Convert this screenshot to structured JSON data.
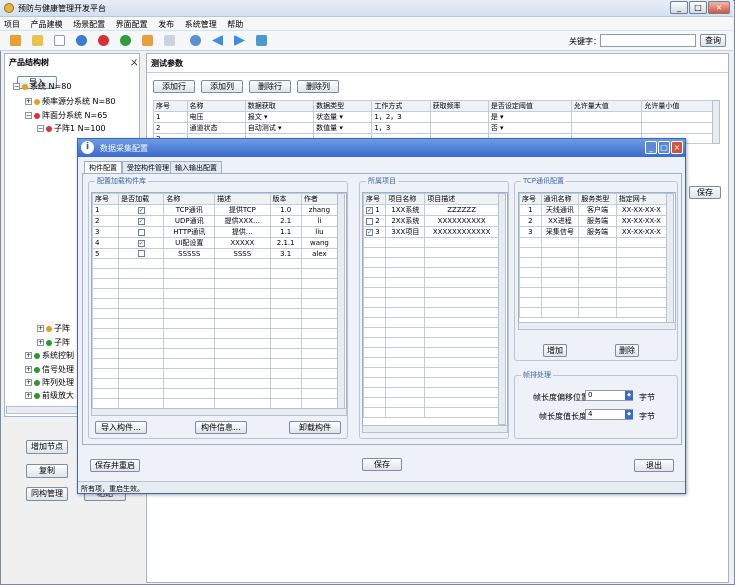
{
  "app": {
    "title": "预防与健康管理开发平台",
    "window_controls": [
      "_",
      "□",
      "×"
    ]
  },
  "menu": [
    "项目",
    "产品建模",
    "场景配置",
    "界面配置",
    "发布",
    "系统管理",
    "帮助"
  ],
  "toolbar": {
    "keyword_label": "关键字：",
    "search_button": "查询",
    "keyword_value": ""
  },
  "left_panel": {
    "title": "产品结构树",
    "pin": "ㄨ",
    "import_button": "导入",
    "tree": [
      {
        "label": "系统 N=80",
        "color": "#e0a020",
        "level": 0,
        "exp": "−"
      },
      {
        "label": "频率源分系统 N=80",
        "color": "#e0a020",
        "level": 1,
        "exp": "+"
      },
      {
        "label": "阵面分系统 N=65",
        "color": "#e03030",
        "level": 1,
        "exp": "−"
      },
      {
        "label": "子阵1 N=100",
        "color": "#e03030",
        "level": 2,
        "exp": "−"
      },
      {
        "label": "子阵",
        "color": "#e0a020",
        "level": 2,
        "exp": "+"
      },
      {
        "label": "子阵",
        "color": "#2a9a2a",
        "level": 2,
        "exp": "+"
      },
      {
        "label": "系统控制",
        "color": "#2a9a2a",
        "level": 1,
        "exp": "+"
      },
      {
        "label": "信号处理",
        "color": "#2a9a2a",
        "level": 1,
        "exp": "+"
      },
      {
        "label": "阵列处理",
        "color": "#2a9a2a",
        "level": 1,
        "exp": "+"
      },
      {
        "label": "前级放大",
        "color": "#2a9a2a",
        "level": 1,
        "exp": "+"
      }
    ],
    "buttons": {
      "add_node": "增加节点",
      "copy": "复制",
      "sync": "同构管理",
      "paste": "粘贴"
    }
  },
  "test_params": {
    "title": "测试参数",
    "buttons": [
      "添加行",
      "添加列",
      "删除行",
      "删除列"
    ],
    "headers": [
      "序号",
      "名称",
      "数据获取",
      "数据类型",
      "工作方式",
      "获取频率",
      "是否设定阈值",
      "允许量大值",
      "允许量小值"
    ],
    "rows": [
      [
        "1",
        "电压",
        "报文",
        "状态量",
        "1，2，3",
        "",
        "是",
        "",
        ""
      ],
      [
        "2",
        "通道状态",
        "自动测试",
        "数值量",
        "1，3",
        "",
        "否",
        "",
        ""
      ],
      [
        "3",
        "",
        "",
        "",
        "",
        "",
        "",
        "",
        ""
      ]
    ],
    "save_button": "保存"
  },
  "dialog": {
    "title": "数据采集配置",
    "tabs": [
      "构件配置",
      "受控构件管理",
      "输入输出配置"
    ],
    "groups": {
      "lib": {
        "label": "配置加载构件库",
        "headers": [
          "序号",
          "是否加载",
          "名称",
          "描述",
          "版本",
          "作者"
        ],
        "rows": [
          {
            "no": "1",
            "checked": true,
            "name": "TCP通讯",
            "desc": "提供TCP",
            "ver": "1.0",
            "author": "zhang"
          },
          {
            "no": "2",
            "checked": true,
            "name": "UDP通讯",
            "desc": "提供XXX…",
            "ver": "2.1",
            "author": "li"
          },
          {
            "no": "3",
            "checked": false,
            "name": "HTTP通讯",
            "desc": "提供…",
            "ver": "1.1",
            "author": "liu"
          },
          {
            "no": "4",
            "checked": true,
            "name": "UI配设置",
            "desc": "XXXXX",
            "ver": "2.1.1",
            "author": "wang"
          },
          {
            "no": "5",
            "checked": false,
            "name": "SSSSS",
            "desc": "SSSS",
            "ver": "3.1",
            "author": "alex"
          }
        ],
        "buttons": [
          "导入构件…",
          "构件信息…",
          "卸载构件"
        ]
      },
      "proj": {
        "label": "所属项目",
        "headers": [
          "序号",
          "项目名称",
          "项目描述"
        ],
        "rows": [
          {
            "no": "1",
            "checked": true,
            "name": "1XX系统",
            "desc": "ZZZZZZ"
          },
          {
            "no": "2",
            "checked": false,
            "name": "2XX系统",
            "desc": "XXXXXXXXXX"
          },
          {
            "no": "3",
            "checked": true,
            "name": "3XX项目",
            "desc": "XXXXXXXXXXXX"
          }
        ]
      },
      "tcp": {
        "label": "TCP通讯配置",
        "headers": [
          "序号",
          "通讯名称",
          "服务类型",
          "指定网卡"
        ],
        "rows": [
          [
            "1",
            "天线通讯",
            "客户端",
            "XX-XX-XX-X"
          ],
          [
            "2",
            "XX进程",
            "服务端",
            "XX-XX-XX-X"
          ],
          [
            "3",
            "采集信号",
            "服务端",
            "XX-XX-XX-X"
          ]
        ],
        "buttons": [
          "增加",
          "删除"
        ]
      },
      "frame": {
        "label": "帧排处理",
        "offset_label": "帧长度偏移位置:",
        "offset_value": "0",
        "offset_unit": "字节",
        "length_label": "帧长度值长度:",
        "length_value": "4",
        "length_unit": "字节"
      }
    },
    "bottom": {
      "save_close": "保存并重启",
      "save": "保存",
      "exit": "退出"
    },
    "status": "所有项，重启生效。"
  }
}
